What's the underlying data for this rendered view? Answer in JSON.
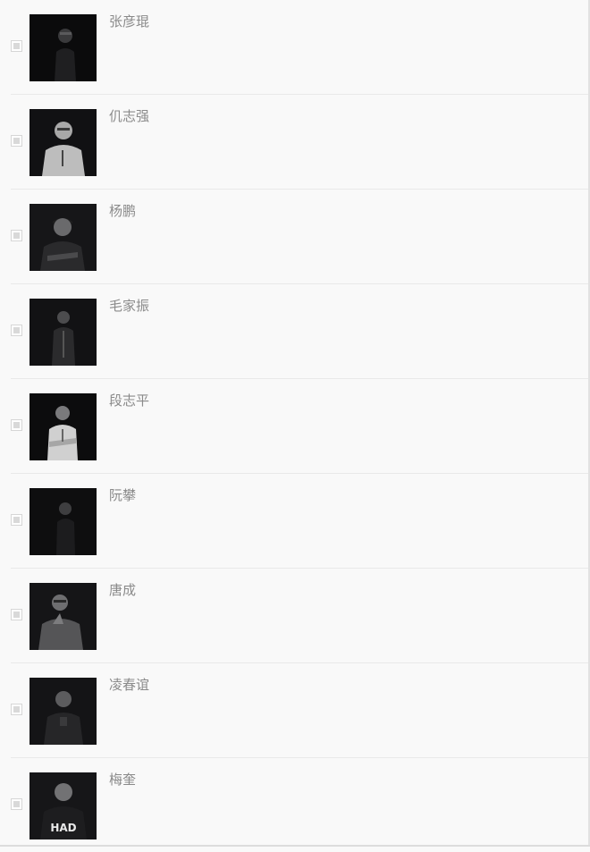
{
  "members": [
    {
      "name": "张彦琨",
      "selected": false
    },
    {
      "name": "仉志强",
      "selected": false
    },
    {
      "name": "杨鹏",
      "selected": false
    },
    {
      "name": "毛家振",
      "selected": false
    },
    {
      "name": "段志平",
      "selected": false
    },
    {
      "name": "阮攀",
      "selected": false
    },
    {
      "name": "唐成",
      "selected": false
    },
    {
      "name": "凌春谊",
      "selected": false
    },
    {
      "name": "梅奎",
      "selected": false,
      "shirt_text": "HAD"
    }
  ]
}
